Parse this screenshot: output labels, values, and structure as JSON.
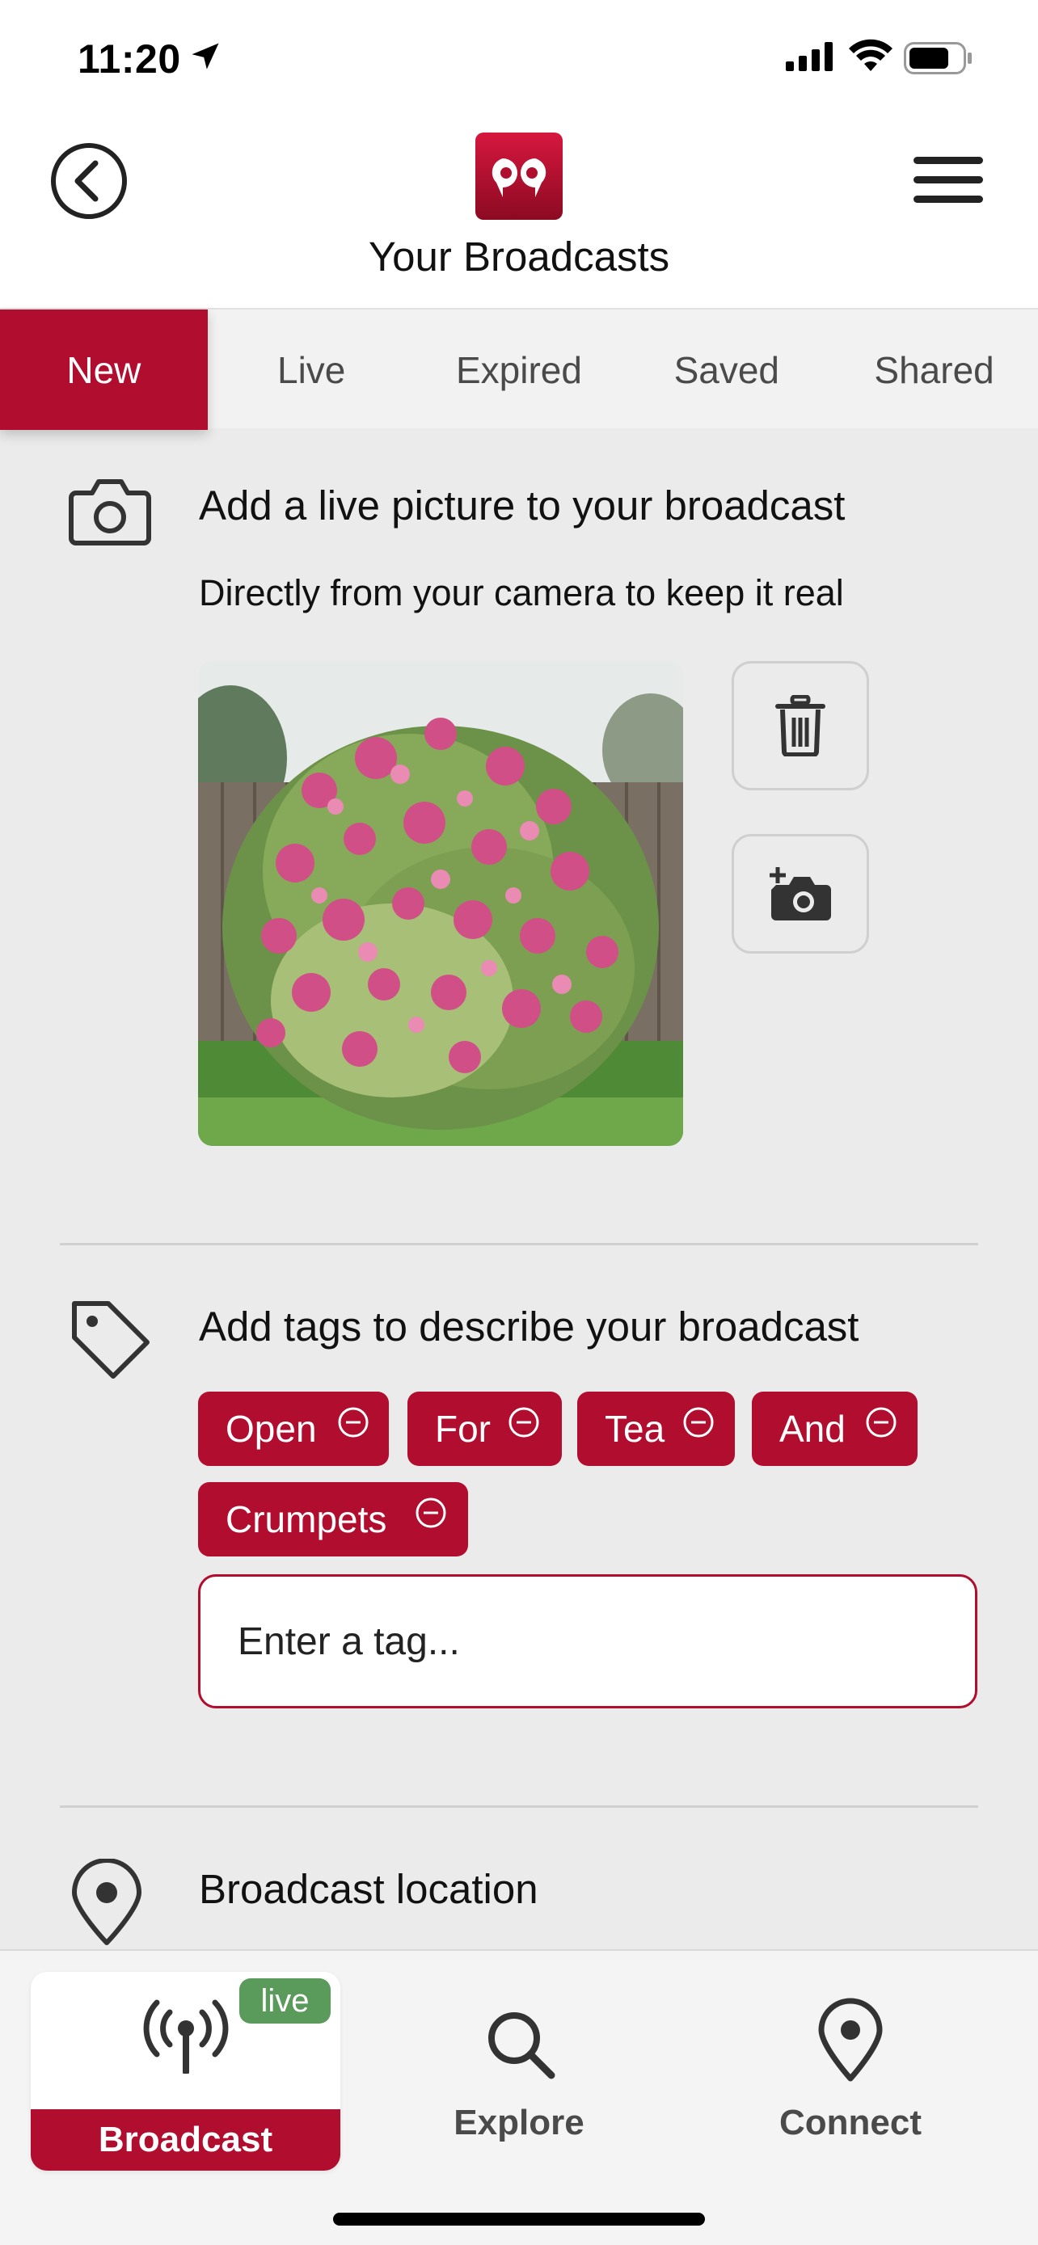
{
  "status_bar": {
    "time": "11:20"
  },
  "header": {
    "title": "Your Broadcasts"
  },
  "tabs": [
    {
      "label": "New",
      "active": true
    },
    {
      "label": "Live",
      "active": false
    },
    {
      "label": "Expired",
      "active": false
    },
    {
      "label": "Saved",
      "active": false
    },
    {
      "label": "Shared",
      "active": false
    }
  ],
  "picture_section": {
    "heading": "Add a live picture to your broadcast",
    "subtext": "Directly from your camera to keep it real",
    "icon": "camera-icon"
  },
  "tags_section": {
    "heading": "Add tags to describe your broadcast",
    "icon": "tag-icon",
    "tags": [
      "Open",
      "For",
      "Tea",
      "And",
      "Crumpets"
    ],
    "input_placeholder": "Enter a tag..."
  },
  "location_section": {
    "heading": "Broadcast location",
    "icon": "location-pin-icon"
  },
  "bottom_nav": {
    "items": [
      {
        "label": "Broadcast",
        "icon": "broadcast-antenna-icon",
        "active": true,
        "badge": "live"
      },
      {
        "label": "Explore",
        "icon": "search-icon",
        "active": false
      },
      {
        "label": "Connect",
        "icon": "location-pin-icon",
        "active": false
      }
    ]
  },
  "colors": {
    "brand": "#b00d2f",
    "live_badge": "#5a9a5a",
    "background": "#ebebeb"
  }
}
